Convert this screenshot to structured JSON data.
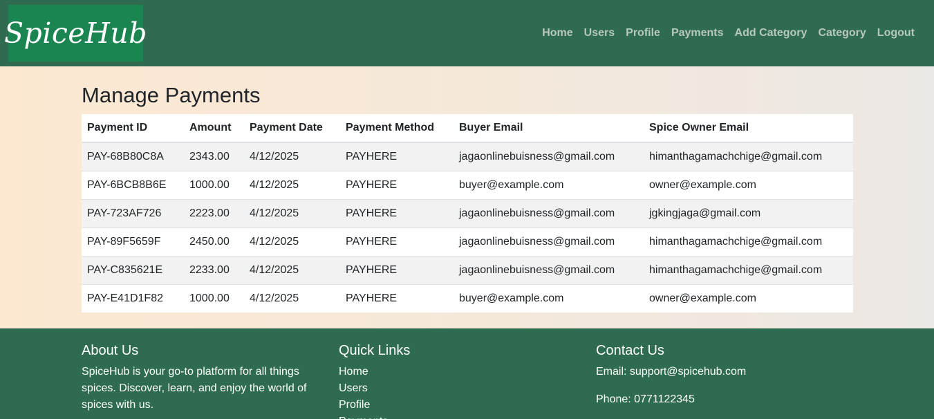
{
  "brand": {
    "logo_text": "SpiceHub"
  },
  "nav": {
    "items": [
      {
        "label": "Home"
      },
      {
        "label": "Users"
      },
      {
        "label": "Profile"
      },
      {
        "label": "Payments"
      },
      {
        "label": "Add Category"
      },
      {
        "label": "Category"
      },
      {
        "label": "Logout"
      }
    ]
  },
  "page": {
    "title": "Manage Payments"
  },
  "table": {
    "headers": [
      "Payment ID",
      "Amount",
      "Payment Date",
      "Payment Method",
      "Buyer Email",
      "Spice Owner Email"
    ],
    "rows": [
      [
        "PAY-68B80C8A",
        "2343.00",
        "4/12/2025",
        "PAYHERE",
        "jagaonlinebuisness@gmail.com",
        "himanthagamachchige@gmail.com"
      ],
      [
        "PAY-6BCB8B6E",
        "1000.00",
        "4/12/2025",
        "PAYHERE",
        "buyer@example.com",
        "owner@example.com"
      ],
      [
        "PAY-723AF726",
        "2223.00",
        "4/12/2025",
        "PAYHERE",
        "jagaonlinebuisness@gmail.com",
        "jgkingjaga@gmail.com"
      ],
      [
        "PAY-89F5659F",
        "2450.00",
        "4/12/2025",
        "PAYHERE",
        "jagaonlinebuisness@gmail.com",
        "himanthagamachchige@gmail.com"
      ],
      [
        "PAY-C835621E",
        "2233.00",
        "4/12/2025",
        "PAYHERE",
        "jagaonlinebuisness@gmail.com",
        "himanthagamachchige@gmail.com"
      ],
      [
        "PAY-E41D1F82",
        "1000.00",
        "4/12/2025",
        "PAYHERE",
        "buyer@example.com",
        "owner@example.com"
      ]
    ]
  },
  "footer": {
    "about": {
      "title": "About Us",
      "text": "SpiceHub is your go-to platform for all things spices. Discover, learn, and enjoy the world of spices with us."
    },
    "quick_links": {
      "title": "Quick Links",
      "items": [
        "Home",
        "Users",
        "Profile",
        "Payments"
      ]
    },
    "contact": {
      "title": "Contact Us",
      "email": "Email: support@spicehub.com",
      "phone": "Phone: 0771122345"
    }
  },
  "colors": {
    "header_bg": "#2e6b50",
    "logo_bg": "#1b8552",
    "footer_bg": "#2e6b50"
  }
}
